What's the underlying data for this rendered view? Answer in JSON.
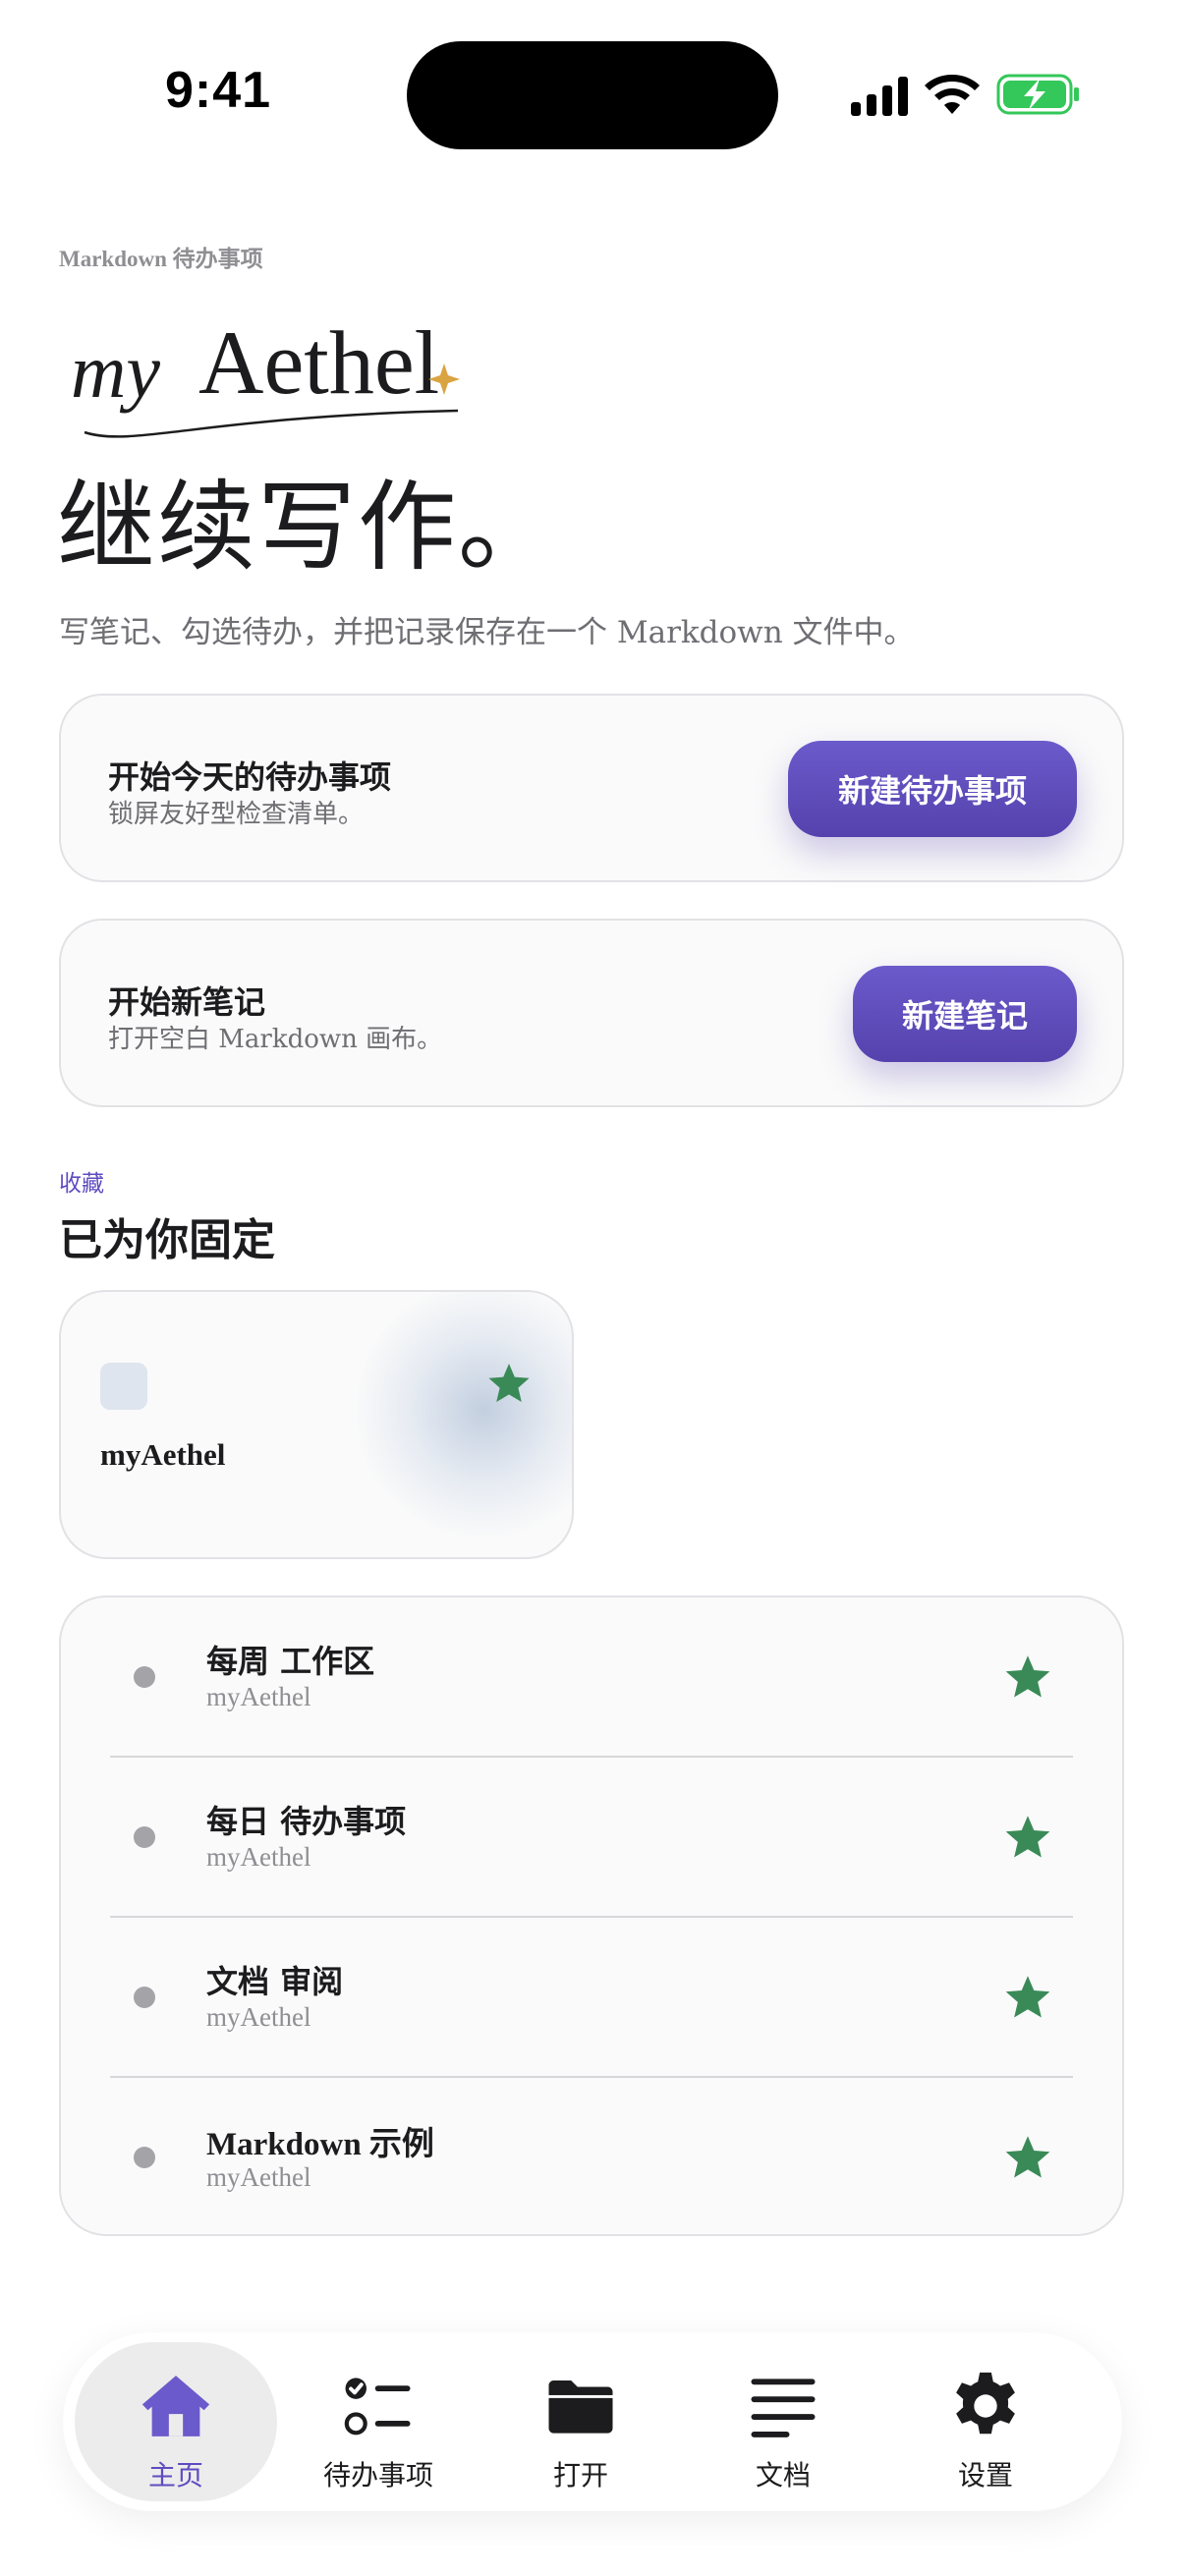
{
  "status_bar": {
    "time": "9:41",
    "icons": [
      "cellular-signal-icon",
      "wifi-icon",
      "battery-charging-icon"
    ]
  },
  "header": {
    "eyebrow": "Markdown 待办事项",
    "logo_text": "myAethel",
    "headline": "继续写作。",
    "subhead": "写笔记、勾选待办，并把记录保存在一个 Markdown 文件中。"
  },
  "cards": [
    {
      "title": "开始今天的待办事项",
      "subtitle": "锁屏友好型检查清单。",
      "button": "新建待办事项"
    },
    {
      "title": "开始新笔记",
      "subtitle": "打开空白 Markdown 画布。",
      "button": "新建笔记"
    }
  ],
  "favorites": {
    "eyebrow": "收藏",
    "title": "已为你固定",
    "pinned": {
      "name": "myAethel"
    },
    "items": [
      {
        "title": "每周 工作区",
        "subtitle": "myAethel"
      },
      {
        "title": "每日 待办事项",
        "subtitle": "myAethel"
      },
      {
        "title": "文档 审阅",
        "subtitle": "myAethel"
      },
      {
        "title": "Markdown 示例",
        "subtitle": "myAethel"
      }
    ]
  },
  "tabbar": {
    "tabs": [
      {
        "label": "主页",
        "icon": "house-icon",
        "active": true
      },
      {
        "label": "待办事项",
        "icon": "checklist-icon",
        "active": false
      },
      {
        "label": "打开",
        "icon": "folder-icon",
        "active": false
      },
      {
        "label": "文档",
        "icon": "text-lines-icon",
        "active": false
      },
      {
        "label": "设置",
        "icon": "gear-icon",
        "active": false
      }
    ]
  },
  "colors": {
    "accent": "#5e4cc0",
    "star": "#3a8a57",
    "logo_sparkle": "#d9a441"
  }
}
